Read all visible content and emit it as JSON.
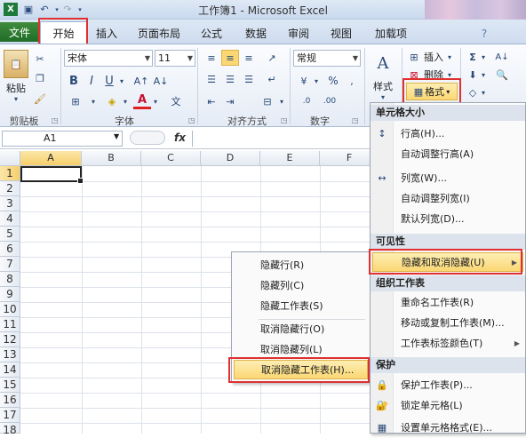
{
  "window": {
    "title": "工作簿1 - Microsoft Excel"
  },
  "tabs": [
    "文件",
    "开始",
    "插入",
    "页面布局",
    "公式",
    "数据",
    "审阅",
    "视图",
    "加载项"
  ],
  "ribbon": {
    "paste": "粘贴",
    "font_name": "宋体",
    "font_size": "11",
    "number_format": "常规",
    "style": "样式",
    "insert": "插入",
    "delete": "删除",
    "format": "格式",
    "groups": {
      "clipboard": "剪贴板",
      "font": "字体",
      "alignment": "对齐方式",
      "number": "数字"
    },
    "bold": "B",
    "italic": "I",
    "underline": "U",
    "percent": "%"
  },
  "formula_bar": {
    "name_box": "A1",
    "fx": "fx"
  },
  "grid": {
    "columns": [
      "A",
      "B",
      "C",
      "D",
      "E",
      "F"
    ],
    "rows": [
      "1",
      "2",
      "3",
      "4",
      "5",
      "6",
      "7",
      "8",
      "9",
      "10",
      "11",
      "12",
      "13",
      "14",
      "15",
      "16",
      "17",
      "18"
    ]
  },
  "format_menu": {
    "cell_size": "单元格大小",
    "row_height": "行高(H)...",
    "autofit_row": "自动调整行高(A)",
    "col_width": "列宽(W)...",
    "autofit_col": "自动调整列宽(I)",
    "default_width": "默认列宽(D)...",
    "visibility": "可见性",
    "hide_unhide": "隐藏和取消隐藏(U)",
    "organize": "组织工作表",
    "rename": "重命名工作表(R)",
    "move_copy": "移动或复制工作表(M)...",
    "tab_color": "工作表标签颜色(T)",
    "protection": "保护",
    "protect_sheet": "保护工作表(P)...",
    "lock_cell": "锁定单元格(L)",
    "format_cells": "设置单元格格式(E)..."
  },
  "hide_menu": {
    "hide_rows": "隐藏行(R)",
    "hide_cols": "隐藏列(C)",
    "hide_sheet": "隐藏工作表(S)",
    "unhide_rows": "取消隐藏行(O)",
    "unhide_cols": "取消隐藏列(L)",
    "unhide_sheet": "取消隐藏工作表(H)..."
  }
}
